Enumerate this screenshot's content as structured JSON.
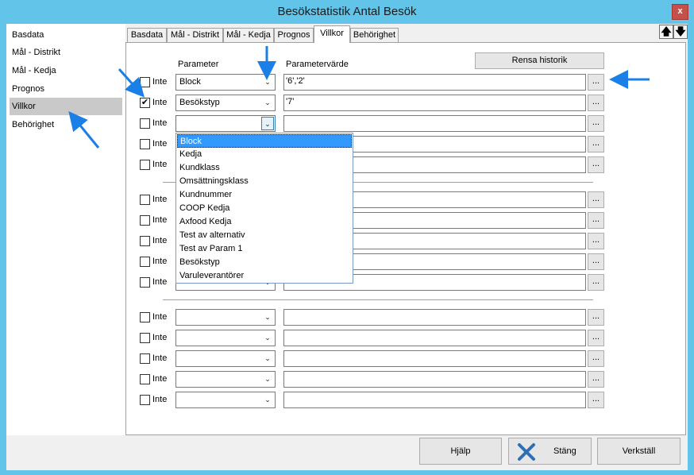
{
  "window": {
    "title": "Besökstatistik Antal Besök",
    "close_glyph": "x"
  },
  "sidebar": {
    "items": [
      {
        "label": "Basdata"
      },
      {
        "label": "Mål - Distrikt"
      },
      {
        "label": "Mål - Kedja"
      },
      {
        "label": "Prognos"
      },
      {
        "label": "Villkor"
      },
      {
        "label": "Behörighet"
      }
    ],
    "selected": "Villkor"
  },
  "tabs": [
    {
      "label": "Basdata"
    },
    {
      "label": "Mål - Distrikt"
    },
    {
      "label": "Mål - Kedja"
    },
    {
      "label": "Prognos"
    },
    {
      "label": "Villkor"
    },
    {
      "label": "Behörighet"
    }
  ],
  "active_tab": "Villkor",
  "nav_arrows": {
    "up": "🡅",
    "down": "🡇"
  },
  "villkor": {
    "col_param": "Parameter",
    "col_value": "Parametervärde",
    "clear_history_label": "Rensa historik",
    "not_label": "Inte",
    "browse_label": "...",
    "rows": [
      {
        "checked": false,
        "param": "Block",
        "value": "'6','2'"
      },
      {
        "checked": true,
        "param": "Besökstyp",
        "value": "'7'"
      },
      {
        "checked": false,
        "param": "",
        "value": ""
      },
      {
        "checked": false,
        "param": "",
        "value": ""
      },
      {
        "checked": false,
        "param": "",
        "value": ""
      },
      {
        "checked": false,
        "param": "",
        "value": ""
      },
      {
        "checked": false,
        "param": "",
        "value": ""
      },
      {
        "checked": false,
        "param": "",
        "value": ""
      },
      {
        "checked": false,
        "param": "",
        "value": ""
      },
      {
        "checked": false,
        "param": "",
        "value": ""
      },
      {
        "checked": false,
        "param": "",
        "value": ""
      },
      {
        "checked": false,
        "param": "",
        "value": ""
      },
      {
        "checked": false,
        "param": "",
        "value": ""
      },
      {
        "checked": false,
        "param": "",
        "value": ""
      },
      {
        "checked": false,
        "param": "",
        "value": ""
      }
    ],
    "dropdown_options": [
      "Block",
      "Kedja",
      "Kundklass",
      "Omsättningsklass",
      "Kundnummer",
      "COOP Kedja",
      "Axfood Kedja",
      "Test av alternativ",
      "Test av Param 1",
      "Besökstyp",
      "Varuleverantörer"
    ],
    "dropdown_highlighted": "Block"
  },
  "footer": {
    "help_label": "Hjälp",
    "close_label": "Stäng",
    "apply_label": "Verkställ"
  },
  "colors": {
    "window_frame": "#62c4e8",
    "selection": "#3399ff",
    "annotation_arrow": "#1a7fe6",
    "close_button": "#c7514a"
  }
}
